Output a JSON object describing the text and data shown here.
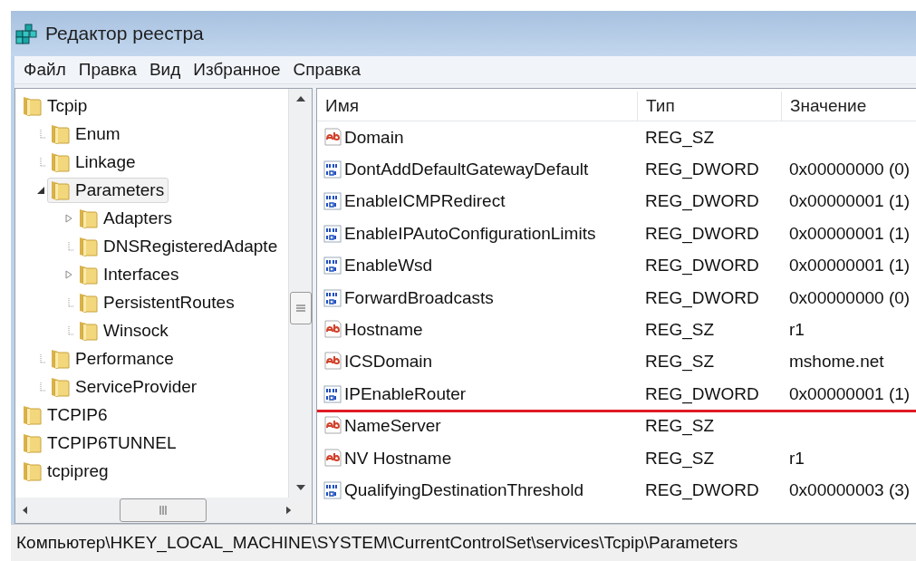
{
  "window": {
    "title": "Редактор реестра"
  },
  "menu": [
    {
      "label": "Файл"
    },
    {
      "label": "Правка"
    },
    {
      "label": "Вид"
    },
    {
      "label": "Избранное"
    },
    {
      "label": "Справка"
    }
  ],
  "tree": [
    {
      "label": "Tcpip",
      "selected": false,
      "children": [
        {
          "label": "Enum",
          "selected": false
        },
        {
          "label": "Linkage",
          "selected": false
        },
        {
          "label": "Parameters",
          "selected": true,
          "expanded": true,
          "children": [
            {
              "label": "Adapters",
              "selected": false,
              "expanded": false
            },
            {
              "label": "DNSRegisteredAdapte",
              "selected": false
            },
            {
              "label": "Interfaces",
              "selected": false,
              "expanded": false
            },
            {
              "label": "PersistentRoutes",
              "selected": false
            },
            {
              "label": "Winsock",
              "selected": false
            }
          ]
        },
        {
          "label": "Performance",
          "selected": false
        },
        {
          "label": "ServiceProvider",
          "selected": false
        }
      ]
    },
    {
      "label": "TCPIP6",
      "selected": false
    },
    {
      "label": "TCPIP6TUNNEL",
      "selected": false
    },
    {
      "label": "tcpipreg",
      "selected": false
    }
  ],
  "table": {
    "columns": [
      "Имя",
      "Тип",
      "Значение"
    ],
    "rows": [
      {
        "kind": "string",
        "name": "Domain",
        "type": "REG_SZ",
        "underlined": false
      },
      {
        "kind": "dword",
        "name": "DontAddDefaultGatewayDefault",
        "type": "REG_DWORD",
        "value": "0x00000000 (0)",
        "underlined": false
      },
      {
        "kind": "dword",
        "name": "EnableICMPRedirect",
        "type": "REG_DWORD",
        "value": "0x00000001 (1)",
        "underlined": false
      },
      {
        "kind": "dword",
        "name": "EnableIPAutoConfigurationLimits",
        "type": "REG_DWORD",
        "value": "0x00000001 (1)",
        "underlined": false
      },
      {
        "kind": "dword",
        "name": "EnableWsd",
        "type": "REG_DWORD",
        "value": "0x00000001 (1)",
        "underlined": false
      },
      {
        "kind": "dword",
        "name": "ForwardBroadcasts",
        "type": "REG_DWORD",
        "value": "0x00000000 (0)",
        "underlined": false
      },
      {
        "kind": "string",
        "name": "Hostname",
        "type": "REG_SZ",
        "value": "r1",
        "underlined": false
      },
      {
        "kind": "string",
        "name": "ICSDomain",
        "type": "REG_SZ",
        "value": "mshome.net",
        "underlined": false
      },
      {
        "kind": "dword",
        "name": "IPEnableRouter",
        "type": "REG_DWORD",
        "value": "0x00000001 (1)",
        "underlined": true
      },
      {
        "kind": "string",
        "name": "NameServer",
        "type": "REG_SZ",
        "underlined": false
      },
      {
        "kind": "string",
        "name": "NV Hostname",
        "type": "REG_SZ",
        "value": "r1",
        "underlined": false
      },
      {
        "kind": "dword",
        "name": "QualifyingDestinationThreshold",
        "type": "REG_DWORD",
        "value": "0x00000003 (3)",
        "underlined": false
      }
    ]
  },
  "status_bar": "Компьютер\\HKEY_LOCAL_MACHINE\\SYSTEM\\CurrentControlSet\\services\\Tcpip\\Parameters"
}
